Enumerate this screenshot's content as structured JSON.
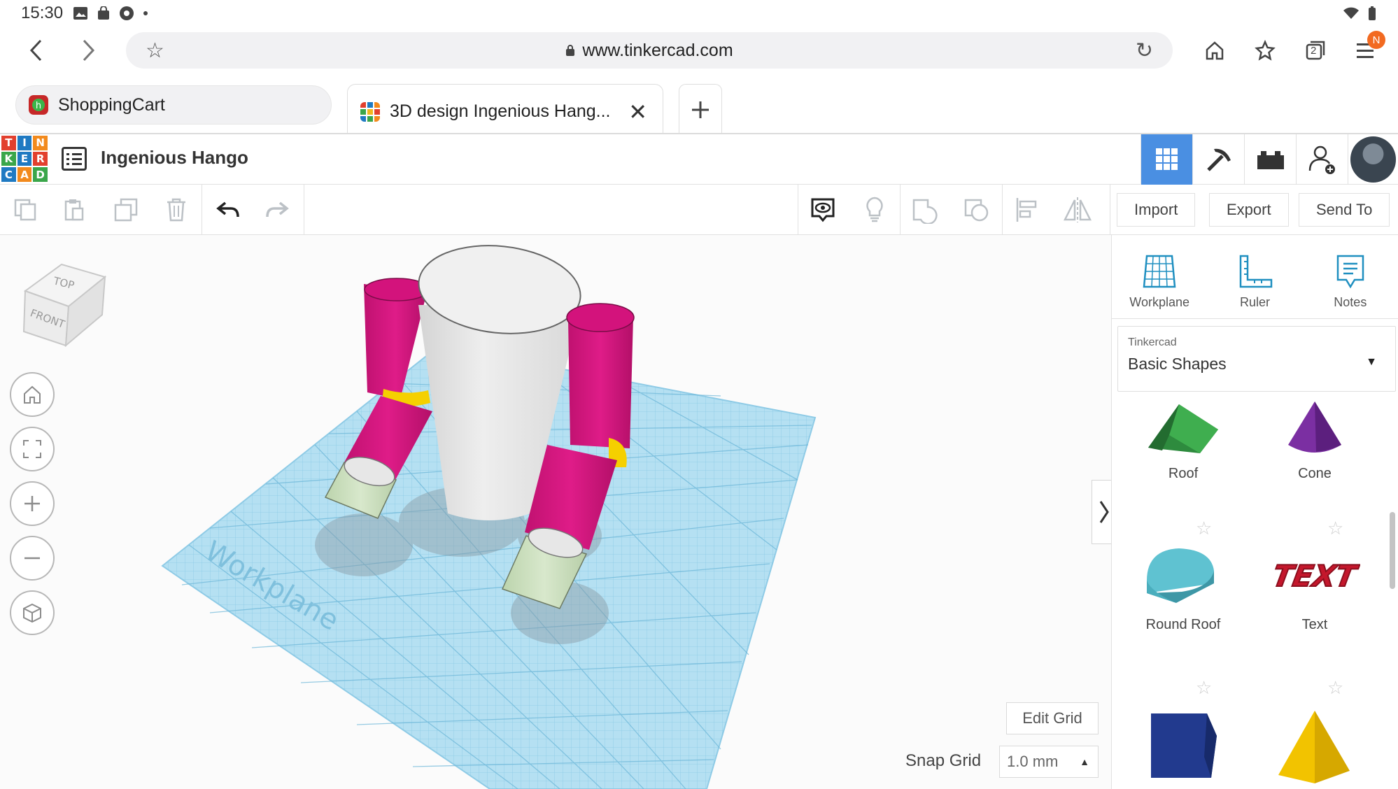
{
  "status": {
    "time": "15:30"
  },
  "browser": {
    "url": "www.tinkercad.com",
    "tabs_count": "2",
    "profile_badge": "N",
    "tabs": [
      {
        "label": "ShoppingCart"
      },
      {
        "label": "3D design Ingenious Hang..."
      }
    ]
  },
  "app": {
    "logo_letters": [
      "T",
      "I",
      "N",
      "K",
      "E",
      "R",
      "C",
      "A",
      "D"
    ],
    "design_title": "Ingenious Hango",
    "toolbar": {
      "import_label": "Import",
      "export_label": "Export",
      "send_to_label": "Send To"
    }
  },
  "viewport": {
    "cube_top": "TOP",
    "cube_front": "FRONT",
    "workplane_text": "Workplane",
    "edit_grid_label": "Edit Grid",
    "snap_grid_label": "Snap Grid",
    "snap_grid_value": "1.0 mm"
  },
  "panel": {
    "tools": [
      {
        "label": "Workplane"
      },
      {
        "label": "Ruler"
      },
      {
        "label": "Notes"
      }
    ],
    "library_source": "Tinkercad",
    "library_name": "Basic Shapes",
    "shapes": [
      {
        "label": "Roof"
      },
      {
        "label": "Cone"
      },
      {
        "label": "Round Roof"
      },
      {
        "label": "Text"
      }
    ],
    "text_shape_word": "TEXT"
  },
  "colors": {
    "accent_blue": "#4a8fe2",
    "magenta_part": "#d6157f",
    "pale_green_part": "#cfe2c0",
    "yellow_joint": "#f5d000",
    "body_grey": "#e9e9e9",
    "workplane": "#a8dbf0"
  }
}
